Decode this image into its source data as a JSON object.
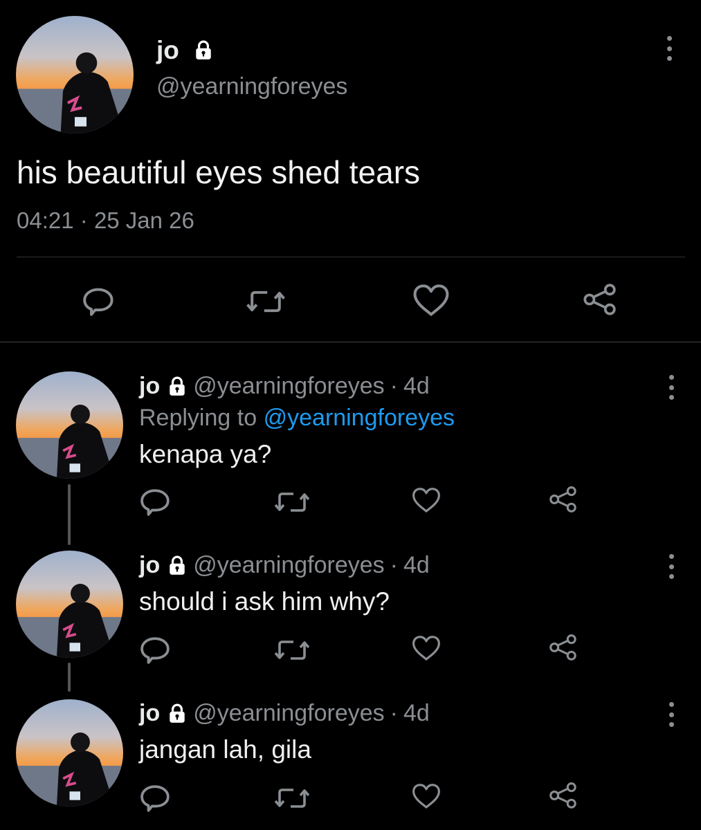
{
  "main_tweet": {
    "name": "jo",
    "handle": "@yearningforeyes",
    "text": "his beautiful eyes shed tears",
    "time": "04:21",
    "separator": "·",
    "date": "25 Jan 26"
  },
  "replies": [
    {
      "name": "jo",
      "handle": "@yearningforeyes",
      "separator": "·",
      "age": "4d",
      "replying_prefix": "Replying to",
      "replying_to": "@yearningforeyes",
      "text": "kenapa ya?"
    },
    {
      "name": "jo",
      "handle": "@yearningforeyes",
      "separator": "·",
      "age": "4d",
      "text": "should i ask him why?"
    },
    {
      "name": "jo",
      "handle": "@yearningforeyes",
      "separator": "·",
      "age": "4d",
      "text": "jangan lah, gila"
    }
  ],
  "icons": {
    "reply": "reply-icon",
    "retweet": "retweet-icon",
    "like": "heart-icon",
    "share": "share-icon",
    "more": "more-options-icon",
    "lock": "lock-icon"
  },
  "colors": {
    "background": "#000000",
    "primary_text": "#e7e9ea",
    "secondary_text": "#8b8f93",
    "mention": "#1d9bf0",
    "icon": "#8b8f93"
  }
}
